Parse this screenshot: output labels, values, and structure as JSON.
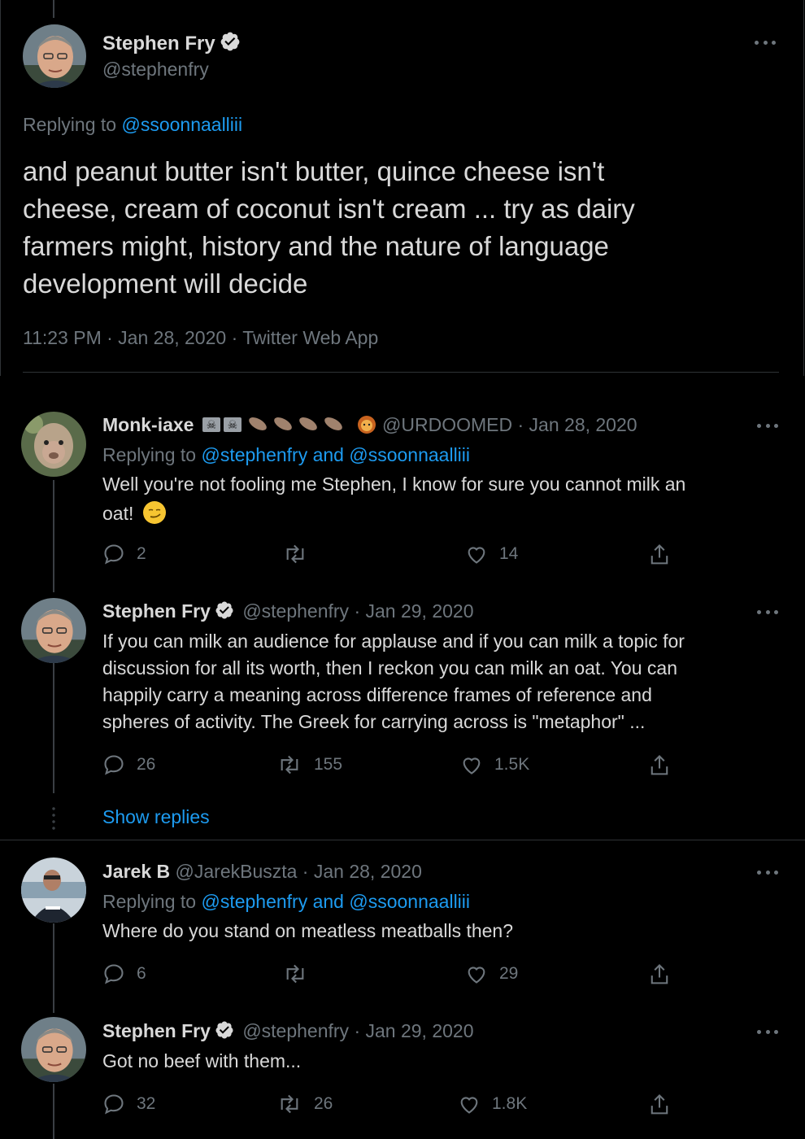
{
  "main_tweet": {
    "name": "Stephen Fry",
    "handle": "@stephenfry",
    "replying_label": "Replying to",
    "replying_to": "@ssoonnaalliii",
    "text_lines": [
      "and peanut butter isn't butter, quince cheese isn't",
      "cheese,  cream of coconut isn't cream ... try as dairy",
      "farmers might, history and the nature of language",
      "development will decide"
    ],
    "meta": "11:23 PM · Jan 28, 2020 · Twitter Web App"
  },
  "replies": [
    {
      "name": "Monk-iaxe",
      "emoji_flags": "☠☠",
      "handle_date": "@URDOOMED · Jan 28, 2020",
      "replying_label": "Replying to",
      "replying_to": "@stephenfry and @ssoonnaalliii",
      "text_lines": [
        "Well you're not fooling me Stephen, I know for sure you cannot milk an",
        "oat!"
      ],
      "emoji_end": "😏",
      "replies_count": "2",
      "retweets_count": "",
      "likes_count": "14"
    },
    {
      "name": "Stephen Fry",
      "handle_date": "@stephenfry · Jan 29, 2020",
      "text_lines": [
        "If you can milk an audience for applause and if you can milk a topic for",
        "discussion for all its worth, then I reckon you can milk an oat. You can",
        "happily carry a meaning across difference frames of reference and",
        "spheres of activity. The Greek for carrying across is \"metaphor\" ..."
      ],
      "replies_count": "26",
      "retweets_count": "155",
      "likes_count": "1.5K"
    },
    {
      "show_replies": "Show replies"
    },
    {
      "name": "Jarek B",
      "handle_date": "@JarekBuszta · Jan 28, 2020",
      "replying_label": "Replying to",
      "replying_to": "@stephenfry and @ssoonnaalliii",
      "text_lines": [
        "Where do you stand on meatless meatballs then?"
      ],
      "replies_count": "6",
      "retweets_count": "",
      "likes_count": "29"
    },
    {
      "name": "Stephen Fry",
      "handle_date": "@stephenfry · Jan 29, 2020",
      "text_lines": [
        "Got no beef with them..."
      ],
      "replies_count": "32",
      "retweets_count": "26",
      "likes_count": "1.8K"
    }
  ],
  "colors": {
    "background": "#000000",
    "text": "#d9d9d9",
    "muted": "#6e767d",
    "link": "#1d9bf0"
  }
}
